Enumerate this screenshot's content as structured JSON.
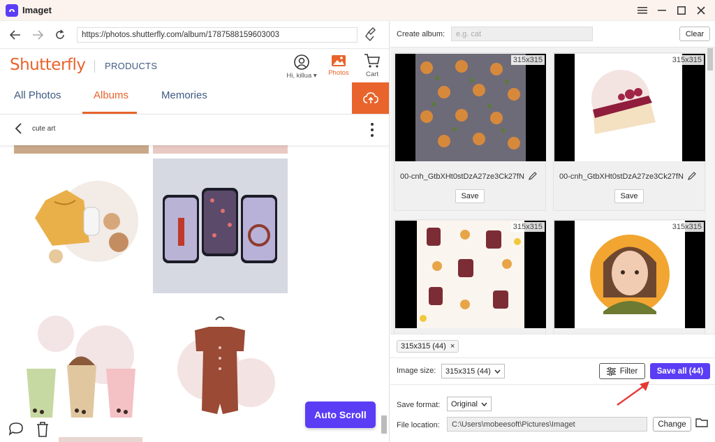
{
  "app": {
    "title": "Imaget"
  },
  "browser": {
    "url": "https://photos.shutterfly.com/album/1787588159603003"
  },
  "shutterfly": {
    "logo": "Shutterfly",
    "products": "PRODUCTS",
    "account_label": "Hi, killua ▾",
    "photos_label": "Photos",
    "cart_label": "Cart",
    "tabs": [
      {
        "label": "All Photos"
      },
      {
        "label": "Albums"
      },
      {
        "label": "Memories"
      }
    ],
    "album_name": "cute art",
    "autoscroll_label": "Auto Scroll"
  },
  "panel": {
    "create_album_label": "Create album:",
    "create_album_placeholder": "e.g. cat",
    "clear_label": "Clear",
    "cards": [
      {
        "size": "315x315",
        "name": "00-cnh_GtbXHt0stDzA27ze3Ck27fN",
        "save": "Save"
      },
      {
        "size": "315x315",
        "name": "00-cnh_GtbXHt0stDzA27ze3Ck27fN",
        "save": "Save"
      },
      {
        "size": "315x315"
      },
      {
        "size": "315x315"
      }
    ],
    "tag_label": "315x315 (44)",
    "tag_close": "×",
    "image_size_label": "Image size:",
    "image_size_value": "315x315 (44)",
    "filter_label": "Filter",
    "save_all_label": "Save all (44)",
    "save_format_label": "Save format:",
    "save_format_value": "Original",
    "file_location_label": "File location:",
    "file_location_value": "C:\\Users\\mobeesoft\\Pictures\\Imaget",
    "change_label": "Change"
  },
  "colors": {
    "accent": "#5b3df5",
    "shutterfly_orange": "#e8642c",
    "shutterfly_blue": "#3d5a80",
    "arrow_red": "#e53935"
  }
}
